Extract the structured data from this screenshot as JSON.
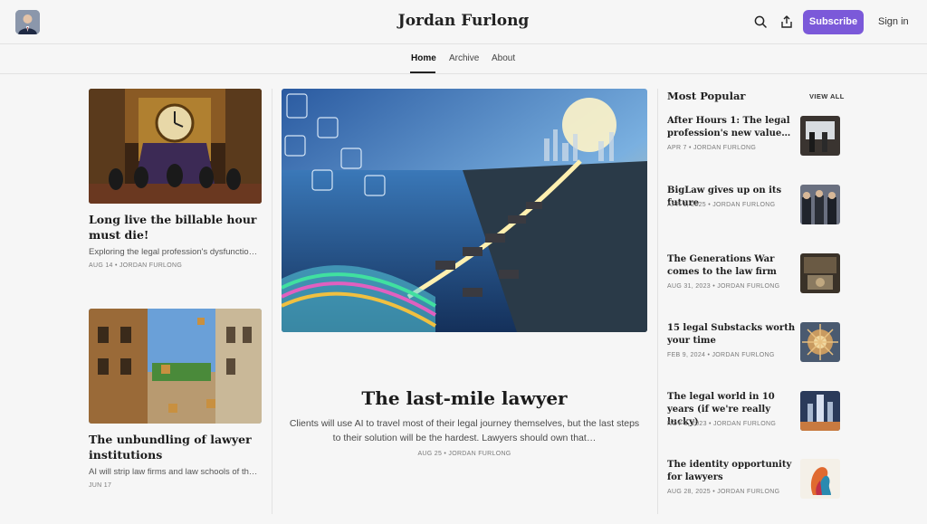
{
  "header": {
    "site_title": "Jordan Furlong",
    "subscribe_label": "Subscribe",
    "signin_label": "Sign in",
    "accent_color": "#7b59d9",
    "icons": [
      "search-icon",
      "share-icon"
    ]
  },
  "nav": {
    "tabs": [
      {
        "label": "Home",
        "active": true
      },
      {
        "label": "Archive",
        "active": false
      },
      {
        "label": "About",
        "active": false
      }
    ]
  },
  "left_posts": [
    {
      "title": "Long live the billable hour must die!",
      "subtitle": "Exploring the legal profession's dysfunction…",
      "meta": "AUG 14 • JORDAN FURLONG"
    },
    {
      "title": "The unbundling of lawyer institutions",
      "subtitle": "AI will strip law firms and law schools of thei…",
      "meta": "JUN 17"
    }
  ],
  "hero": {
    "title": "The last-mile lawyer",
    "subtitle": "Clients will use AI to travel most of their legal journey themselves, but the last steps to their solution will be the hardest. Lawyers should own that…",
    "meta": "AUG 25 • JORDAN FURLONG"
  },
  "most_popular": {
    "heading": "Most Popular",
    "view_all": "VIEW ALL",
    "items": [
      {
        "title": "After Hours 1: The legal profession's new value…",
        "meta": "APR 7 • JORDAN FURLONG"
      },
      {
        "title": "BigLaw gives up on its future",
        "meta": "APR 1, 2025 • JORDAN FURLONG"
      },
      {
        "title": "The Generations War comes to the law firm",
        "meta": "AUG 31, 2023 • JORDAN FURLONG"
      },
      {
        "title": "15 legal Substacks worth your time",
        "meta": "FEB 9, 2024 • JORDAN FURLONG"
      },
      {
        "title": "The legal world in 10 years (if we're really lucky)",
        "meta": "NOV 3, 2023 • JORDAN FURLONG"
      },
      {
        "title": "The identity opportunity for lawyers",
        "meta": "AUG 28, 2025 • JORDAN FURLONG"
      }
    ]
  }
}
